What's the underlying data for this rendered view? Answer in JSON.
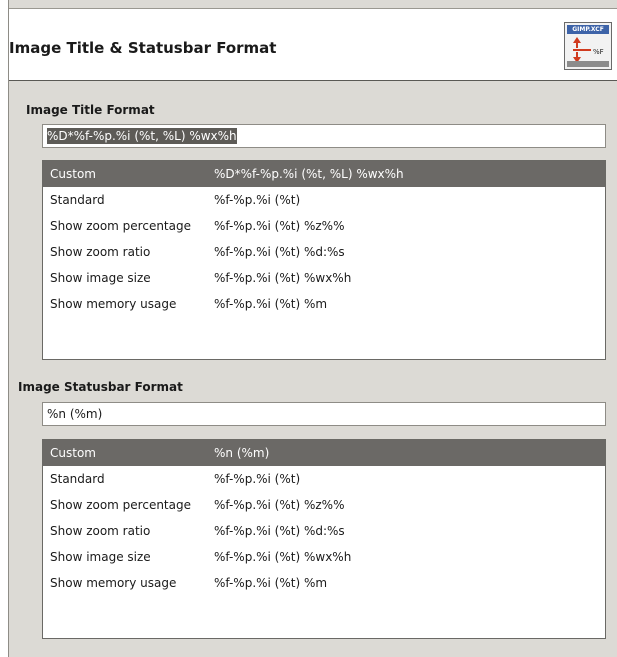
{
  "header": {
    "title": "Image Title & Statusbar Format",
    "icon": "gimp-format-icon",
    "icon_text": "GIMP.XCF"
  },
  "title_section": {
    "label": "Image Title Format",
    "entry_value": "%D*%f-%p.%i (%t, %L) %wx%h",
    "rows": [
      {
        "name": "Custom",
        "format": "%D*%f-%p.%i (%t, %L) %wx%h",
        "selected": true
      },
      {
        "name": "Standard",
        "format": "%f-%p.%i (%t)"
      },
      {
        "name": "Show zoom percentage",
        "format": "%f-%p.%i (%t) %z%%"
      },
      {
        "name": "Show zoom ratio",
        "format": "%f-%p.%i (%t) %d:%s"
      },
      {
        "name": "Show image size",
        "format": "%f-%p.%i (%t) %wx%h"
      },
      {
        "name": "Show memory usage",
        "format": "%f-%p.%i (%t) %m"
      }
    ]
  },
  "statusbar_section": {
    "label": "Image Statusbar Format",
    "entry_value": "%n (%m)",
    "rows": [
      {
        "name": "Custom",
        "format": "%n (%m)",
        "selected": true
      },
      {
        "name": "Standard",
        "format": "%f-%p.%i (%t)"
      },
      {
        "name": "Show zoom percentage",
        "format": "%f-%p.%i (%t) %z%%"
      },
      {
        "name": "Show zoom ratio",
        "format": "%f-%p.%i (%t) %d:%s"
      },
      {
        "name": "Show image size",
        "format": "%f-%p.%i (%t) %wx%h"
      },
      {
        "name": "Show memory usage",
        "format": "%f-%p.%i (%t) %m"
      }
    ]
  }
}
